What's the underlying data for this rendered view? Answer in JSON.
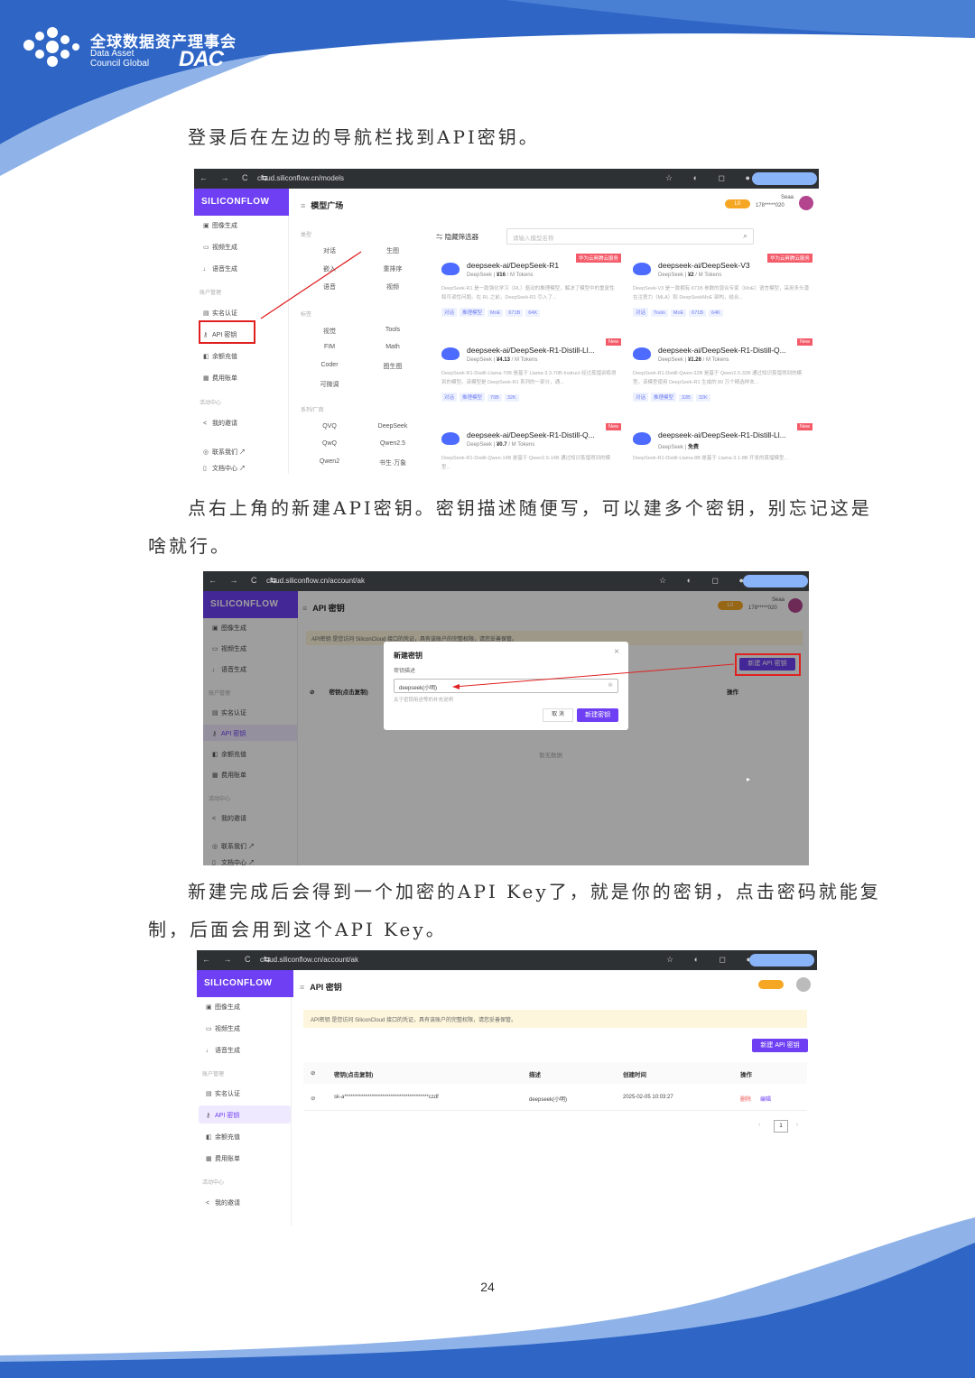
{
  "header": {
    "org_cn": "全球数据资产理事会",
    "org_en_line1": "Data Asset",
    "org_en_line2": "Council Global",
    "org_abbr": "DAC",
    "accent": "#2f66c6"
  },
  "paragraphs": [
    "登录后在左边的导航栏找到API密钥。",
    "点右上角的新建API密钥。密钥描述随便写，可以建多个密钥，别忘记这是",
    "啥就行。",
    "新建完成后会得到一个加密的API Key了，就是你的密钥，点击密码就能复",
    "制，后面会用到这个API Key。"
  ],
  "page_number": "24",
  "brand": "SILICONFLOW",
  "shot1": {
    "url": "cloud.siliconflow.cn/models",
    "title": "模型广场",
    "user": "Seaa",
    "phone": "178*****020",
    "level": "L0",
    "sidebar": [
      "图像生成",
      "视频生成",
      "语音生成",
      "账户管理",
      "实名认证",
      "API 密钥",
      "余额充值",
      "费用账单",
      "活动中心",
      "我的邀请",
      "联系我们 ↗",
      "文档中心 ↗"
    ],
    "filter_button": "隐藏筛选器",
    "search_placeholder": "请输入模型名称",
    "filter_sec1": "类型",
    "filter_sec2": "标签",
    "filter_sec3": "系列/厂商",
    "filters_type": [
      "对话",
      "生图",
      "嵌入",
      "重排序",
      "语音",
      "视频"
    ],
    "filters_tag": [
      "视觉",
      "Tools",
      "FIM",
      "Math",
      "Coder",
      "图生图",
      "可微调"
    ],
    "filters_vendor": [
      "QVQ",
      "DeepSeek",
      "QwQ",
      "Qwen2.5",
      "Qwen2",
      "书生·万象"
    ],
    "cards": [
      {
        "name": "deepseek-ai/DeepSeek-R1",
        "vendor": "DeepSeek",
        "price": "¥16",
        "unit": "/ M Tokens",
        "badge": "华为云昇腾云服务",
        "desc": "DeepSeek-R1 是一款强化学习（RL）驱动的推理模型，解决了模型中的重复性和可读性问题。在 RL 之前，DeepSeek-R1 引入了...",
        "tags": [
          "对话",
          "推理模型",
          "MoE",
          "671B",
          "64K"
        ]
      },
      {
        "name": "deepseek-ai/DeepSeek-V3",
        "vendor": "DeepSeek",
        "price": "¥2",
        "unit": "/ M Tokens",
        "badge": "华为云昇腾云服务",
        "desc": "DeepSeek-V3 是一款拥有 671B 参数的混合专家（MoE）语言模型，采用多头潜在注意力（MLA）和 DeepSeekMoE 架构，结合...",
        "tags": [
          "对话",
          "Tools",
          "MoE",
          "671B",
          "64K"
        ]
      },
      {
        "name": "deepseek-ai/DeepSeek-R1-Distill-Ll...",
        "vendor": "DeepSeek",
        "price": "¥4.13",
        "unit": "/ M Tokens",
        "badge": "New",
        "desc": "DeepSeek-R1-Distill-Llama-70B 是基于 Llama-3.3-70B-Instruct 经过蒸馏训练得到的模型。该模型是 DeepSeek-R1 系列的一部分，通...",
        "tags": [
          "对话",
          "推理模型",
          "70B",
          "32K"
        ]
      },
      {
        "name": "deepseek-ai/DeepSeek-R1-Distill-Q...",
        "vendor": "DeepSeek",
        "price": "¥1.26",
        "unit": "/ M Tokens",
        "badge": "New",
        "desc": "DeepSeek-R1-Distill-Qwen-32B 是基于 Qwen2.5-32B 通过知识蒸馏得到的模型。该模型使用 DeepSeek-R1 生成的 80 万个精选样本...",
        "tags": [
          "对话",
          "推理模型",
          "32B",
          "32K"
        ]
      },
      {
        "name": "deepseek-ai/DeepSeek-R1-Distill-Q...",
        "vendor": "DeepSeek",
        "price": "¥0.7",
        "unit": "/ M Tokens",
        "badge": "New",
        "desc": "DeepSeek-R1-Distill-Qwen-14B 是基于 Qwen2.5-14B 通过知识蒸馏得到的模型...",
        "tags": []
      },
      {
        "name": "deepseek-ai/DeepSeek-R1-Distill-Ll...",
        "vendor": "DeepSeek",
        "price": "免费",
        "unit": "",
        "badge": "New",
        "desc": "DeepSeek-R1-Distill-Llama-8B 是基于 Llama-3.1-8B 开发的蒸馏模型...",
        "tags": []
      }
    ]
  },
  "shot2": {
    "url": "cloud.siliconflow.cn/account/ak",
    "title": "API 密钥",
    "notice": "API密钥 是您访问 SiliconCloud 接口的凭证，具有该账户的完整权限，请您妥善保管。",
    "col_key": "密钥(点击复制)",
    "col_action": "操作",
    "new_button": "新建 API 密钥",
    "empty": "暂无数据",
    "dialog_title": "新建密钥",
    "dialog_label": "密钥描述",
    "dialog_value": "deepseek(小明)",
    "dialog_hint": "关于密钥用途等的补充说明",
    "cancel": "取 消",
    "confirm": "新建密钥"
  },
  "shot3": {
    "url": "cloud.siliconflow.cn/account/ak",
    "title": "API 密钥",
    "notice": "API密钥 是您访问 SiliconCloud 接口的凭证，具有该账户的完整权限，请您妥善保管。",
    "new_button": "新建 API 密钥",
    "columns": [
      "密钥(点击复制)",
      "描述",
      "创建时间",
      "操作"
    ],
    "row": {
      "key": "sk-a****************************************czdf",
      "desc": "deepseek(小明)",
      "time": "2025-02-05 10:03:27",
      "del": "删除",
      "edit": "编辑"
    },
    "page": "1"
  }
}
